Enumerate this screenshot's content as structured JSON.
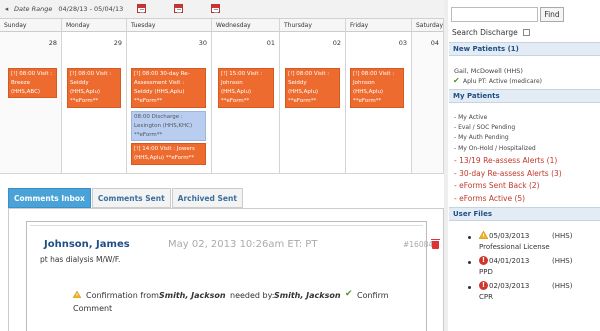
{
  "toolbar": {
    "prev_glyph": "◂",
    "date_range_label": "Date Range",
    "date_range_value": "04/28/13 - 05/04/13"
  },
  "calendar": {
    "day_names": [
      "Sunday",
      "Monday",
      "Tuesday",
      "Wednesday",
      "Thursday",
      "Friday",
      "Saturday"
    ],
    "day_numbers": [
      "28",
      "29",
      "30",
      "01",
      "02",
      "03",
      "04"
    ]
  },
  "events": [
    "[!] 08:00 Visit : Breeze (HHS,ABC)",
    "[!] 08:00 Visit : Seiddy (HHS,Aplu) **eForm**",
    "[!] 08:00 30-day Re-Assessment Visit : Seiddy (HHS,Aplu) **eForm**",
    "08:00 Discharge : Lexington (HHS,KHC) **eForm**",
    "[!] 14:00 Visit : Jowers (HHS,Aplu) **eForm**",
    "[!] 15:00 Visit : Johnson (HHS,Aplu) **eForm**",
    "[!] 08:00 Visit : Seiddy (HHS,Aplu) **eForm**",
    "[!] 08:00 Visit : Johnson (HHS,Aplu) **eForm**"
  ],
  "tabs": [
    "Comments Inbox",
    "Comments Sent",
    "Archived Sent"
  ],
  "comment": {
    "author": "Johnson, James",
    "date": "May 02, 2013 10:26am ET: PT",
    "id": "#16084",
    "body": "pt has dialysis M/W/F.",
    "confirm_prefix": "Confirmation from",
    "confirm_from": "Smith, Jackson",
    "needed_by_label": "needed by:",
    "needed_by": "Smith, Jackson",
    "confirm_link": "Confirm",
    "comment_link": "Comment"
  },
  "sidebar": {
    "find_label": "Find",
    "search_discharge": "Search Discharge",
    "new_patients": {
      "title": "New Patients (1)",
      "patient": "Gail, McDowell (HHS)",
      "status": "Aplu PT: Active (medicare)"
    },
    "my_patients": {
      "title": "My Patients",
      "items": [
        "My Active",
        "Eval / SOC Pending",
        "My Auth Pending",
        "My On-Hold / Hospitalized"
      ],
      "alerts": [
        "13/19 Re-assess Alerts (1)",
        "30-day Re-assess Alerts (3)",
        "eForms Sent Back (2)",
        "eForms Active (5)"
      ]
    },
    "user_files": {
      "title": "User Files",
      "files": [
        {
          "date": "05/03/2013",
          "org": "(HHS)",
          "name": "Professional License"
        },
        {
          "date": "04/01/2013",
          "org": "(HHS)",
          "name": "PPD"
        },
        {
          "date": "02/03/2013",
          "org": "(HHS)",
          "name": "CPR"
        }
      ]
    }
  }
}
